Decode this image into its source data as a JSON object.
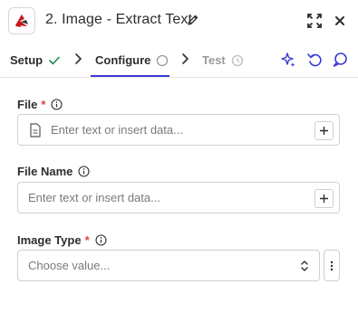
{
  "header": {
    "title": "2. Image - Extract Text",
    "logo": "app-logo",
    "icons": [
      "edit-icon",
      "expand-icon",
      "close-icon"
    ]
  },
  "tabs": [
    {
      "label": "Setup",
      "status_icon": "check-icon"
    },
    {
      "label": "Configure",
      "status_icon": "circle-icon"
    },
    {
      "label": "Test",
      "status_icon": "timer-icon"
    }
  ],
  "toolbar_icons": [
    "sparkle-icon",
    "undo-icon",
    "comment-icon"
  ],
  "colors": {
    "accent": "#3b3bd6",
    "required": "#e0442f",
    "check": "#1f8a4c"
  },
  "fields": {
    "file": {
      "label": "File",
      "required_mark": "*",
      "placeholder": "Enter text or insert data..."
    },
    "file_name": {
      "label": "File Name",
      "placeholder": "Enter text or insert data..."
    },
    "image_type": {
      "label": "Image Type",
      "required_mark": "*",
      "placeholder": "Choose value..."
    }
  }
}
